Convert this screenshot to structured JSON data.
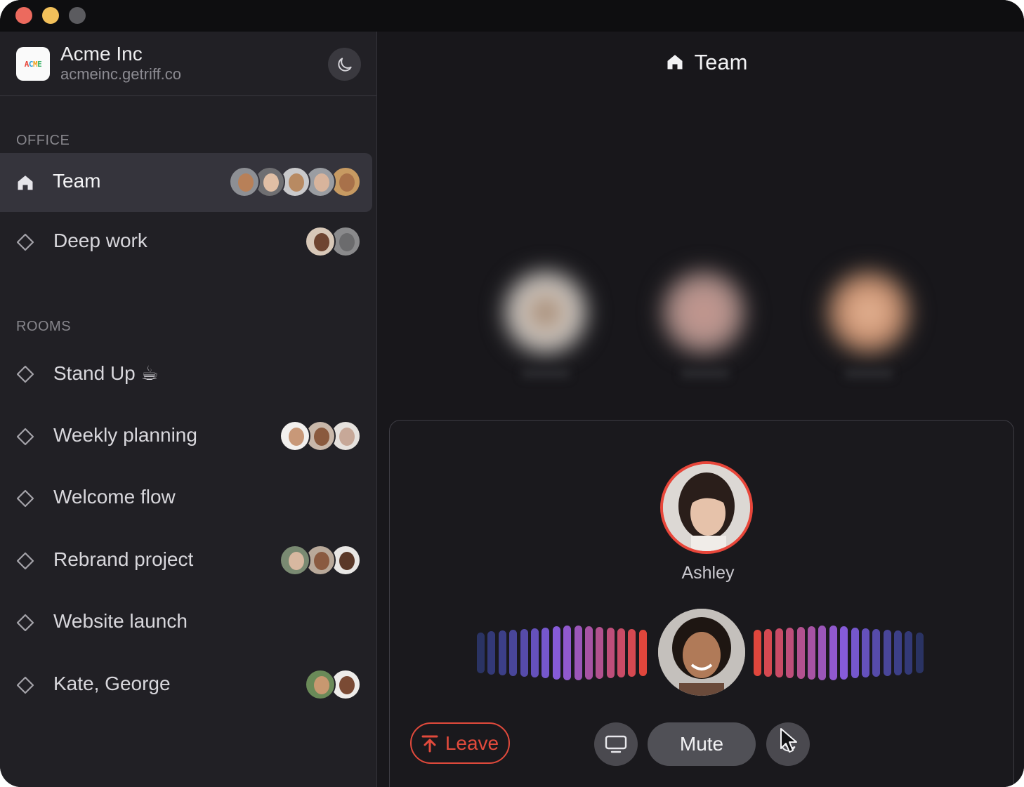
{
  "window": {
    "controls": [
      "close",
      "minimize",
      "maximize"
    ]
  },
  "workspace": {
    "name": "Acme Inc",
    "domain": "acmeinc.getriff.co",
    "logo_text": "ACME",
    "theme_toggle_icon": "moon-icon"
  },
  "sidebar": {
    "sections": [
      {
        "label": "OFFICE",
        "items": [
          {
            "label": "Team",
            "icon": "home-icon",
            "active": true,
            "avatar_count": 5
          },
          {
            "label": "Deep work",
            "icon": "diamond-icon",
            "active": false,
            "avatar_count": 2
          }
        ]
      },
      {
        "label": "ROOMS",
        "items": [
          {
            "label": "Stand Up ☕",
            "icon": "diamond-icon",
            "avatar_count": 0
          },
          {
            "label": "Weekly planning",
            "icon": "diamond-icon",
            "avatar_count": 3
          },
          {
            "label": "Welcome flow",
            "icon": "diamond-icon",
            "avatar_count": 0
          },
          {
            "label": "Rebrand project",
            "icon": "diamond-icon",
            "avatar_count": 3
          },
          {
            "label": "Website launch",
            "icon": "diamond-icon",
            "avatar_count": 0
          },
          {
            "label": "Kate, George",
            "icon": "diamond-icon",
            "avatar_count": 2
          }
        ]
      }
    ]
  },
  "main": {
    "title": "Team",
    "title_icon": "home-icon",
    "call": {
      "speaker_name": "Ashley",
      "leave_label": "Leave",
      "mute_label": "Mute",
      "screen_share_icon": "monitor-icon",
      "dnd_icon": "moon-icon"
    }
  },
  "colors": {
    "accent_red": "#e24a3c",
    "sidebar_bg": "#212025",
    "main_bg": "#18171b",
    "active_item_bg": "#35343c",
    "wave_blue": "#4a63e8",
    "wave_purple": "#8a5ad8",
    "wave_red": "#e0463c"
  }
}
